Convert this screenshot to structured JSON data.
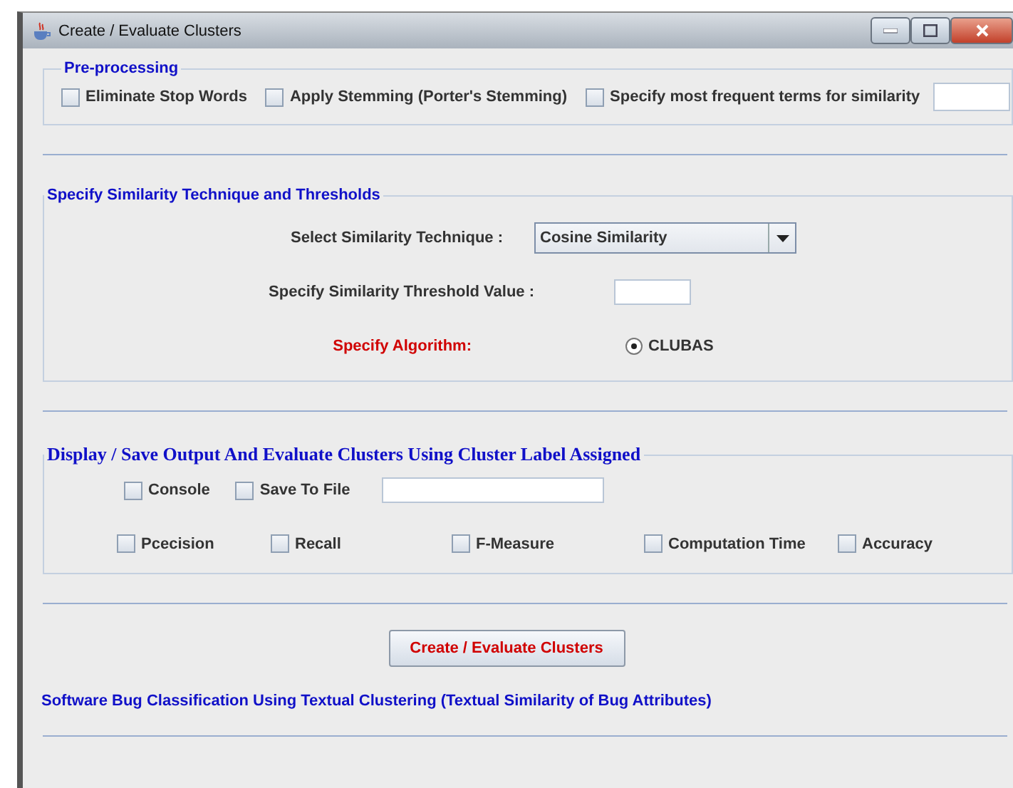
{
  "window": {
    "title": "Create / Evaluate Clusters"
  },
  "preprocessing": {
    "title": "Pre-processing",
    "options": [
      {
        "label": "Eliminate Stop Words",
        "checked": false
      },
      {
        "label": "Apply Stemming (Porter's Stemming)",
        "checked": false
      },
      {
        "label": "Specify most frequent terms for similarity",
        "checked": false
      }
    ]
  },
  "similarity": {
    "title": "Specify Similarity Technique and Thresholds",
    "technique_label": "Select Similarity Technique :",
    "technique_value": "Cosine Similarity",
    "threshold_label": "Specify Similarity Threshold Value :",
    "algorithm_label": "Specify Algorithm:",
    "algorithms": [
      {
        "label": "CLUBAS",
        "selected": true
      }
    ]
  },
  "output": {
    "title": "Display / Save Output And Evaluate Clusters Using Cluster Label Assigned",
    "display_options": [
      {
        "label": "Console",
        "checked": false
      },
      {
        "label": "Save To File",
        "checked": false
      }
    ],
    "metrics": [
      {
        "label": "Pcecision",
        "checked": false
      },
      {
        "label": "Recall",
        "checked": false
      },
      {
        "label": "F-Measure",
        "checked": false
      },
      {
        "label": "Computation Time",
        "checked": false
      },
      {
        "label": "Accuracy",
        "checked": false
      }
    ]
  },
  "action_button": "Create / Evaluate Clusters",
  "footer": "Software Bug Classification Using Textual Clustering (Textual Similarity of Bug Attributes)"
}
